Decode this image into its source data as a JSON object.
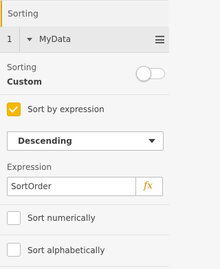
{
  "section": {
    "title": "Sorting"
  },
  "field": {
    "index": "1",
    "name": "MyData"
  },
  "sorting": {
    "label": "Sorting",
    "mode": "Custom"
  },
  "sort_by_expression": {
    "label": "Sort by expression",
    "checked": true
  },
  "order_dropdown": {
    "selected": "Descending"
  },
  "expression": {
    "label": "Expression",
    "value": "SortOrder",
    "fx_label": "fx"
  },
  "sort_numerically": {
    "label": "Sort numerically",
    "checked": false
  },
  "sort_alphabetically": {
    "label": "Sort alphabetically",
    "checked": false
  },
  "colors": {
    "accent": "#f5b800",
    "fx": "#d28a00"
  },
  "icons": {
    "caret": "caret-down-icon",
    "menu": "hamburger-menu-icon",
    "toggle": "toggle-switch",
    "check": "check-icon",
    "dropdown_arrow": "dropdown-arrow-icon",
    "fx": "fx-icon"
  }
}
